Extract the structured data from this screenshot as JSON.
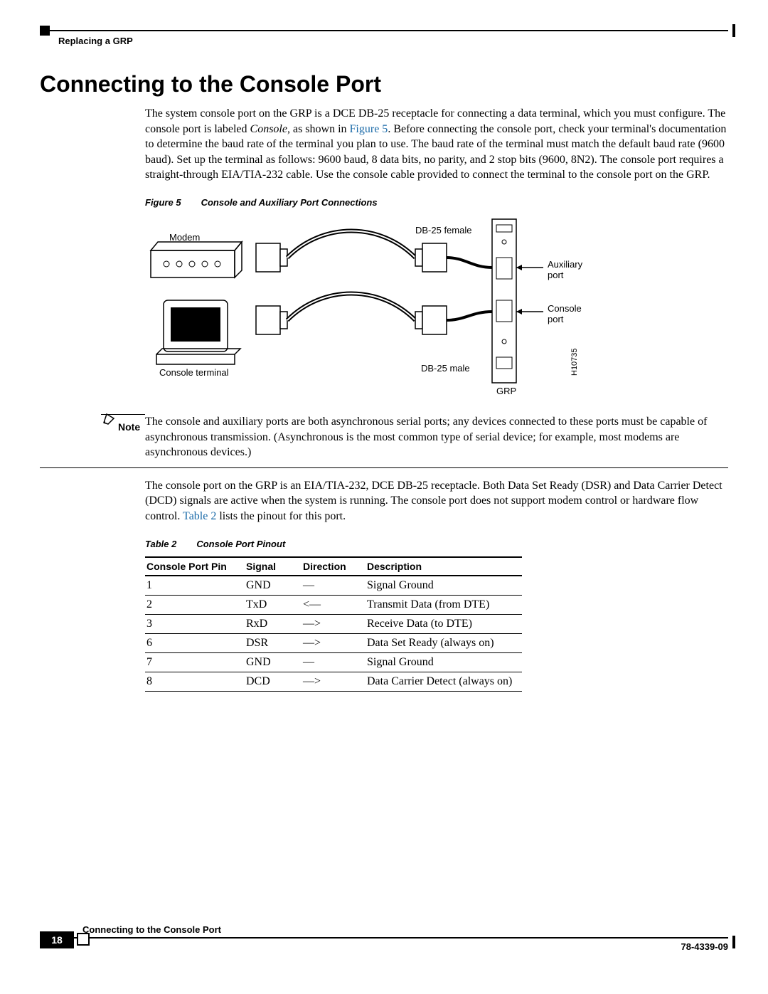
{
  "running_header": {
    "section": "Replacing a GRP"
  },
  "running_footer": {
    "section": "Connecting to the Console Port",
    "page_number": "18",
    "doc_id": "78-4339-09"
  },
  "heading": "Connecting to the Console Port",
  "para1_pre": "The system console port on the GRP is a DCE DB-25 receptacle for connecting a data terminal, which you must configure. The console port is labeled ",
  "para1_console": "Console",
  "para1_mid": ", as shown in ",
  "para1_fig": "Figure 5",
  "para1_post": ". Before connecting the console port, check your terminal's documentation to determine the baud rate of the terminal you plan to use. The baud rate of the terminal must match the default baud rate (9600 baud). Set up the terminal as follows: 9600 baud, 8 data bits, no parity, and 2 stop bits (9600, 8N2). The console port requires a straight-through EIA/TIA-232 cable. Use the console cable provided to connect the terminal to the console port on the GRP.",
  "figure": {
    "label": "Figure 5",
    "title": "Console and Auxiliary Port Connections",
    "modem": "Modem",
    "console_terminal": "Console terminal",
    "db25f": "DB-25 female",
    "db25m": "DB-25 male",
    "aux_port": "Auxiliary port",
    "console_port": "Console port",
    "grp": "GRP",
    "dwg_id": "H10735"
  },
  "note": {
    "label": "Note",
    "text": "The console and auxiliary ports are both asynchronous serial ports; any devices connected to these ports must be capable of asynchronous transmission. (Asynchronous is the most common type of serial device; for example, most modems are asynchronous devices.)"
  },
  "para2_pre": "The console port on the GRP is an EIA/TIA-232, DCE DB-25 receptacle. Both Data Set Ready (DSR) and Data Carrier Detect (DCD) signals are active when the system is running. The console port does not support modem control or hardware flow control. ",
  "para2_tbl": "Table 2",
  "para2_post": " lists the pinout for this port.",
  "table": {
    "label": "Table 2",
    "title": "Console Port Pinout",
    "headers": {
      "pin": "Console Port Pin",
      "signal": "Signal",
      "direction": "Direction",
      "description": "Description"
    },
    "rows": [
      {
        "pin": "1",
        "signal": "GND",
        "direction": "—",
        "description": "Signal Ground"
      },
      {
        "pin": "2",
        "signal": "TxD",
        "direction": "<—",
        "description": "Transmit Data (from DTE)"
      },
      {
        "pin": "3",
        "signal": "RxD",
        "direction": "—>",
        "description": "Receive Data (to DTE)"
      },
      {
        "pin": "6",
        "signal": "DSR",
        "direction": "—>",
        "description": "Data Set Ready (always on)"
      },
      {
        "pin": "7",
        "signal": "GND",
        "direction": "—",
        "description": "Signal Ground"
      },
      {
        "pin": "8",
        "signal": "DCD",
        "direction": "—>",
        "description": "Data Carrier Detect (always on)"
      }
    ]
  }
}
